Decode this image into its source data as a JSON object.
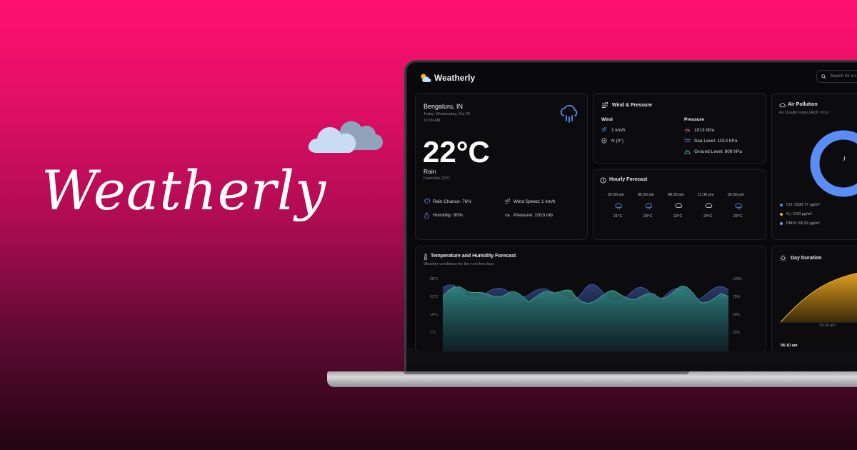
{
  "brand": {
    "wordmark": "Weatherly"
  },
  "app": {
    "title": "Weatherly",
    "search_placeholder": "Search for a c"
  },
  "current": {
    "location": "Bengaluru, IN",
    "date": "Today, Wednesday, Oct 23",
    "time": "12:09 AM",
    "temperature": "22°C",
    "condition": "Rain",
    "feels_like": "Feels like 22°C",
    "rain_chance": "Rain Chance: 76%",
    "wind_speed": "Wind Speed: 1 km/h",
    "humidity": "Humidity: 90%",
    "pressure": "Pressure: 1013 mb"
  },
  "wind_pressure": {
    "title": "Wind & Pressure",
    "wind_heading": "Wind",
    "wind_speed": "1 km/h",
    "wind_direction": "N (0°)",
    "pressure_heading": "Pressure",
    "pressure": "1013 hPa",
    "sea_level": "Sea Level: 1013 hPa",
    "ground_level": "Ground Level: 909 hPa"
  },
  "hourly": {
    "title": "Hourly Forecast",
    "items": [
      {
        "time": "02:30 am",
        "icon": "rain-icon",
        "temp": "21°C"
      },
      {
        "time": "05:30 am",
        "icon": "rain-icon",
        "temp": "20°C"
      },
      {
        "time": "08:30 am",
        "icon": "cloud-icon",
        "temp": "22°C"
      },
      {
        "time": "11:30 am",
        "icon": "cloud-icon",
        "temp": "24°C"
      },
      {
        "time": "02:30 pm",
        "icon": "rain-icon",
        "temp": "23°C"
      }
    ]
  },
  "air": {
    "title": "Air Pollution",
    "aqi": "Air Quality Index (AQI): Poor",
    "pollutants": [
      {
        "label": "CO: 2536.77 μg/m³",
        "color": "#4f8ef7"
      },
      {
        "label": "O₃: 0.00 μg/m³",
        "color": "#f3b43a"
      },
      {
        "label": "PM10: 66.93 μg/m³",
        "color": "#9b8cf0"
      }
    ]
  },
  "forecast_chart": {
    "title": "Temperature and Humidity Forecast",
    "subtitle": "Weather conditions for the next few days",
    "left_ticks": [
      "28°C",
      "21°C",
      "14°C",
      "7°C"
    ],
    "right_ticks": [
      "100%",
      "75%",
      "50%",
      "25%"
    ]
  },
  "day_duration": {
    "title": "Day Duration",
    "tick": "10:20 am",
    "sunrise": "06:10 am"
  },
  "colors": {
    "accent_blue": "#5b8df7",
    "teal": "#2f8f80",
    "navy": "#2a3a6a",
    "sun": "#e8a321"
  }
}
